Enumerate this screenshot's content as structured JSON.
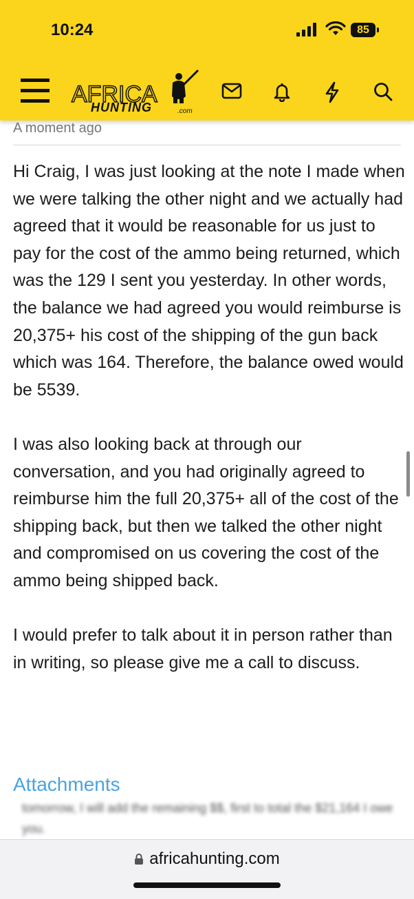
{
  "status_bar": {
    "time": "10:24",
    "battery": "85",
    "icons": [
      "cellular-signal-icon",
      "wifi-icon",
      "battery-icon"
    ]
  },
  "header": {
    "logo_primary": "AFRICA",
    "logo_secondary": "HUNTING",
    "logo_suffix": ".com",
    "icons": [
      "hamburger-menu-icon",
      "envelope-icon",
      "bell-icon",
      "lightning-icon",
      "search-icon"
    ],
    "background_color": "#fbd51b"
  },
  "post": {
    "timestamp": "A moment ago",
    "paragraphs": [
      "Hi Craig, I was just looking at the note I made when we were talking the other night and we actually had agreed that it would be reasonable for us just to pay for the cost of the ammo being returned, which was the 129 I sent you yesterday. In other words, the balance we had agreed you would reimburse is 20,375+ his cost of the shipping of the gun back which was 164. Therefore, the balance owed would be 5539.",
      "I was also looking back at through our conversation, and you had originally agreed to reimburse him the full 20,375+ all of the cost of the shipping back, but then we talked the other night and compromised on us covering the cost of the ammo being shipped back.",
      "I would prefer to talk about it in person rather than in writing, so please give me a call to discuss."
    ],
    "attachments_label": "Attachments",
    "attachment_preview_text": "tomorrow, I will add the remaining $$, first to total the $21,164 I owe you.",
    "link_color": "#4aa3e0"
  },
  "browser": {
    "url": "africahunting.com",
    "lock_icon": "lock-icon"
  }
}
